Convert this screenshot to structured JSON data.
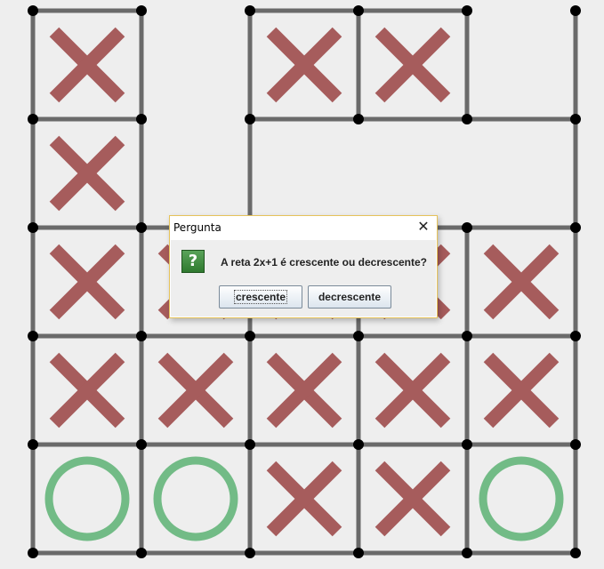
{
  "board": {
    "cols": 5,
    "rows": 5,
    "cells": [
      [
        "X",
        "",
        "X",
        "X",
        ""
      ],
      [
        "X",
        "",
        "",
        "",
        ""
      ],
      [
        "X",
        "X",
        "X",
        "X",
        "X"
      ],
      [
        "X",
        "X",
        "X",
        "X",
        "X"
      ],
      [
        "O",
        "O",
        "X",
        "X",
        "O"
      ]
    ],
    "colors": {
      "line": "#6a6a6a",
      "dot": "#000000",
      "x_mark": "#a65c5c",
      "o_mark": "#72bb86",
      "background": "#eeeeee"
    }
  },
  "dialog": {
    "title": "Pergunta",
    "close_symbol": "✕",
    "icon_symbol": "?",
    "question": "A reta 2x+1 é crescente ou decrescente?",
    "buttons": [
      "crescente",
      "decrescente"
    ]
  }
}
